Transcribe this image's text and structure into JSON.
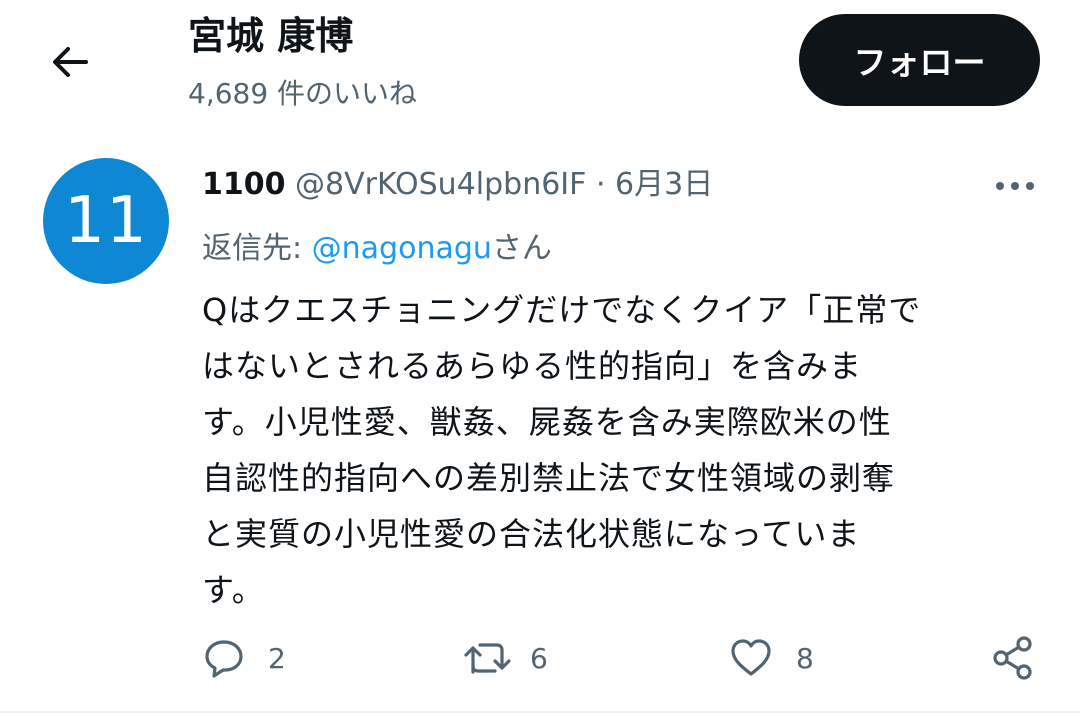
{
  "header": {
    "title": "宮城 康博",
    "subtitle": "4,689 件のいいね",
    "follow_label": "フォロー"
  },
  "tweet": {
    "avatar_text": "11",
    "display_name": "1100",
    "handle": "@8VrKOSu4lpbn6IF",
    "separator": "·",
    "date": "6月3日",
    "reply_prefix": "返信先: ",
    "reply_handle": "@nagonagu",
    "reply_suffix": "さん",
    "body_lines": [
      "Qはクエスチョニングだけでなくクイア「正常で",
      "はないとされるあらゆる性的指向」を含みま",
      "す。小児性愛、獣姦、屍姦を含み実際欧米の性",
      "自認性的指向への差別禁止法で女性領域の剥奪",
      "と実質の小児性愛の合法化状態になっていま",
      "す。"
    ],
    "actions": {
      "reply_count": "2",
      "retweet_count": "6",
      "like_count": "8"
    }
  },
  "icons": {
    "back": "arrow-left-icon",
    "more": "more-horizontal-icon",
    "reply": "reply-bubble-icon",
    "retweet": "retweet-icon",
    "like": "heart-icon",
    "share": "share-icon"
  },
  "colors": {
    "accent_link": "#1d9bf0",
    "avatar_bg": "#0e87d4",
    "follow_bg": "#0f1419",
    "secondary_text": "#536471"
  }
}
